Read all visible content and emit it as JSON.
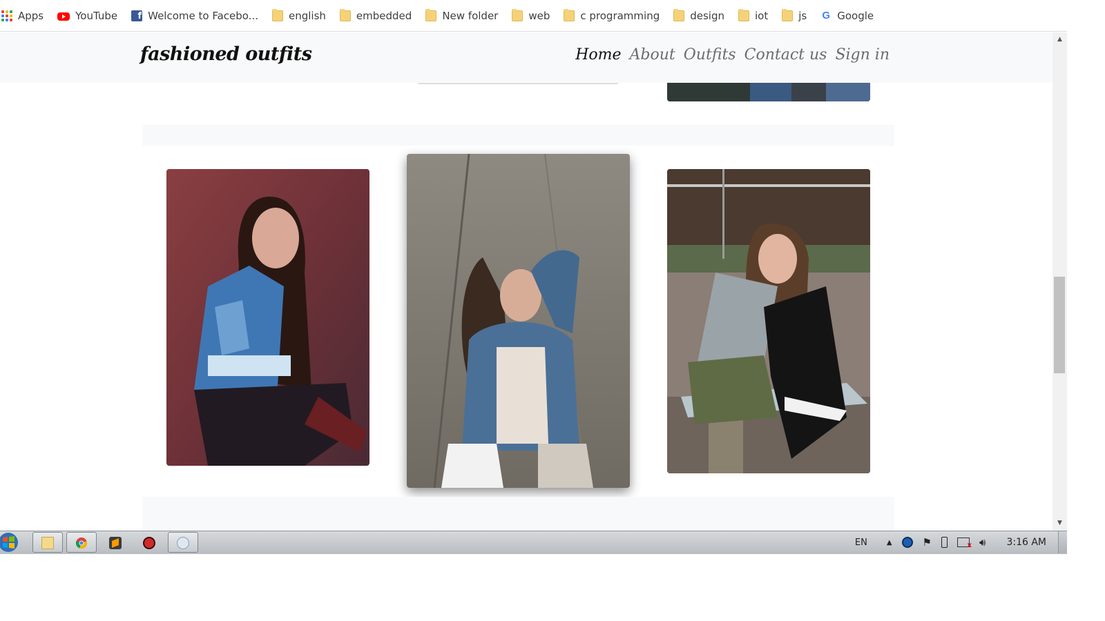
{
  "bookmarks": [
    {
      "label": "Apps",
      "icon": "apps-grid-icon"
    },
    {
      "label": "YouTube",
      "icon": "youtube-icon"
    },
    {
      "label": "Welcome to Facebo...",
      "icon": "facebook-icon"
    },
    {
      "label": "english",
      "icon": "folder-icon"
    },
    {
      "label": "embedded",
      "icon": "folder-icon"
    },
    {
      "label": "New folder",
      "icon": "folder-icon"
    },
    {
      "label": "web",
      "icon": "folder-icon"
    },
    {
      "label": "c programming",
      "icon": "folder-icon"
    },
    {
      "label": "design",
      "icon": "folder-icon"
    },
    {
      "label": "iot",
      "icon": "folder-icon"
    },
    {
      "label": "js",
      "icon": "folder-icon"
    },
    {
      "label": "Google",
      "icon": "google-icon"
    }
  ],
  "site": {
    "brand": "fashioned outfits",
    "nav": [
      {
        "label": "Home",
        "active": true
      },
      {
        "label": "About",
        "active": false
      },
      {
        "label": "Outfits",
        "active": false
      },
      {
        "label": "Contact us",
        "active": false
      },
      {
        "label": "Sign in",
        "active": false
      }
    ]
  },
  "gallery": {
    "photos": [
      {
        "subject": "woman in denim jacket crouching by red stone wall"
      },
      {
        "subject": "woman in denim jacket sitting on pavement, hand in hair"
      },
      {
        "subject": "woman in grey tank top sitting on park bench"
      }
    ]
  },
  "taskbar": {
    "language": "EN",
    "time": "3:16 AM",
    "apps": [
      "explorer-icon",
      "chrome-icon",
      "sublime-text-icon",
      "app-red-icon",
      "paint-icon"
    ]
  },
  "colors": {
    "navbar_bg": "#f8f9fa",
    "brand_text": "#111111",
    "nav_inactive": "#6c6c6c"
  }
}
